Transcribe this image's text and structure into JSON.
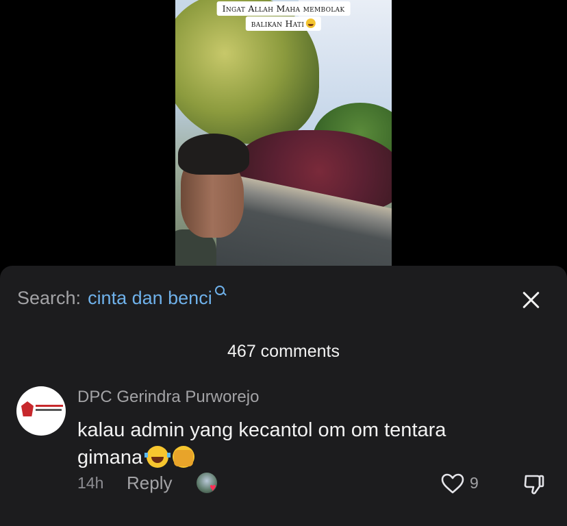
{
  "video": {
    "caption_line1": "Ingat Allah Maha membolak",
    "caption_line2": "balikan Hati"
  },
  "search": {
    "label": "Search:",
    "term": "cinta dan benci"
  },
  "comments": {
    "count_label": "467 comments",
    "items": [
      {
        "author": "DPC Gerindra Purworejo",
        "text": "kalau admin yang kecantol om om tentara gimana",
        "emojis": [
          "face-with-tears-of-joy",
          "face-with-open-eyes-and-hand-over-mouth"
        ],
        "time": "14h",
        "reply_label": "Reply",
        "likes": "9"
      }
    ]
  },
  "colors": {
    "sheet_bg": "#1c1c1e",
    "accent_link": "#6fb1ea",
    "heart": "#ff2f57"
  }
}
